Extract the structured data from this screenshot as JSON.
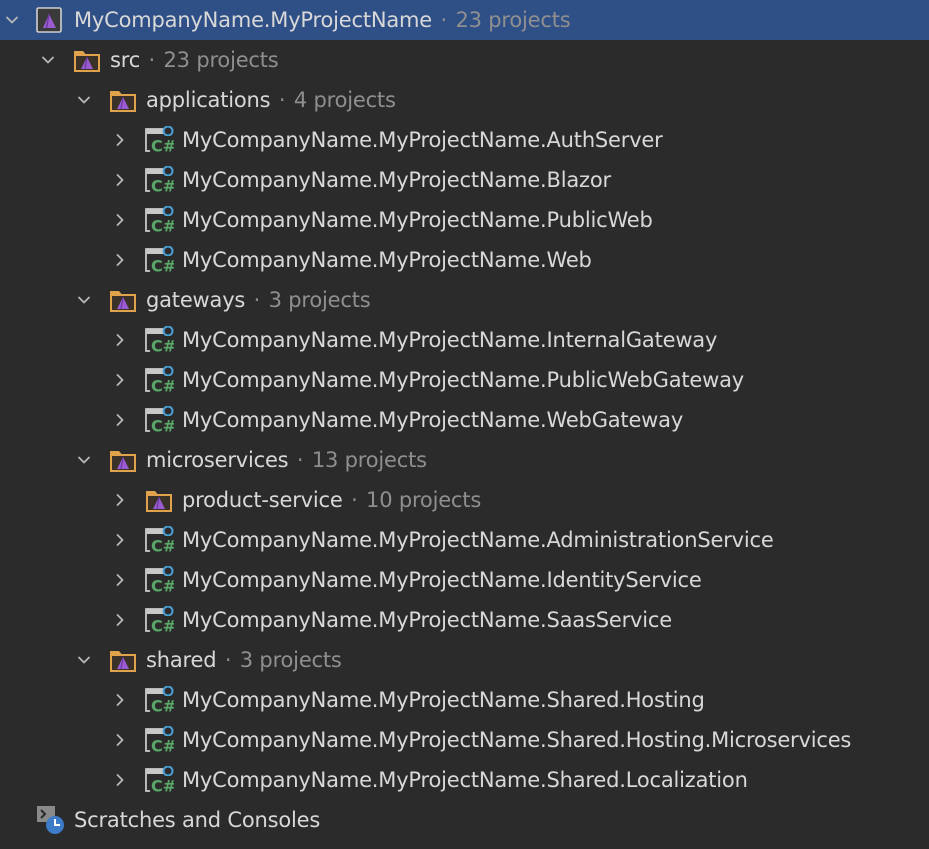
{
  "tree": {
    "solution": {
      "label": "MyCompanyName.MyProjectName",
      "count": "23 projects"
    },
    "src": {
      "label": "src",
      "count": "23 projects"
    },
    "applications": {
      "label": "applications",
      "count": "4 projects",
      "projects": [
        "MyCompanyName.MyProjectName.AuthServer",
        "MyCompanyName.MyProjectName.Blazor",
        "MyCompanyName.MyProjectName.PublicWeb",
        "MyCompanyName.MyProjectName.Web"
      ]
    },
    "gateways": {
      "label": "gateways",
      "count": "3 projects",
      "projects": [
        "MyCompanyName.MyProjectName.InternalGateway",
        "MyCompanyName.MyProjectName.PublicWebGateway",
        "MyCompanyName.MyProjectName.WebGateway"
      ]
    },
    "microservices": {
      "label": "microservices",
      "count": "13 projects",
      "folder": {
        "label": "product-service",
        "count": "10 projects"
      },
      "projects": [
        "MyCompanyName.MyProjectName.AdministrationService",
        "MyCompanyName.MyProjectName.IdentityService",
        "MyCompanyName.MyProjectName.SaasService"
      ]
    },
    "shared": {
      "label": "shared",
      "count": "3 projects",
      "projects": [
        "MyCompanyName.MyProjectName.Shared.Hosting",
        "MyCompanyName.MyProjectName.Shared.Hosting.Microservices",
        "MyCompanyName.MyProjectName.Shared.Localization"
      ]
    },
    "scratches": {
      "label": "Scratches and Consoles"
    },
    "separator": "·"
  },
  "colors": {
    "background": "#2b2b2b",
    "selection": "#2f4f87",
    "text": "#d8d8d8",
    "muted_text": "#8f8f8f",
    "folder_orange": "#e0a24a",
    "solution_purple": "#9b5bd1",
    "csharp_green": "#59a869",
    "csharp_blue": "#4a9fd6"
  },
  "icons": {
    "expanded": "chevron-down-icon",
    "collapsed": "chevron-right-icon",
    "solution": "solution-icon",
    "solution_folder": "solution-folder-icon",
    "project": "csharp-project-icon",
    "scratches": "scratches-consoles-icon"
  }
}
